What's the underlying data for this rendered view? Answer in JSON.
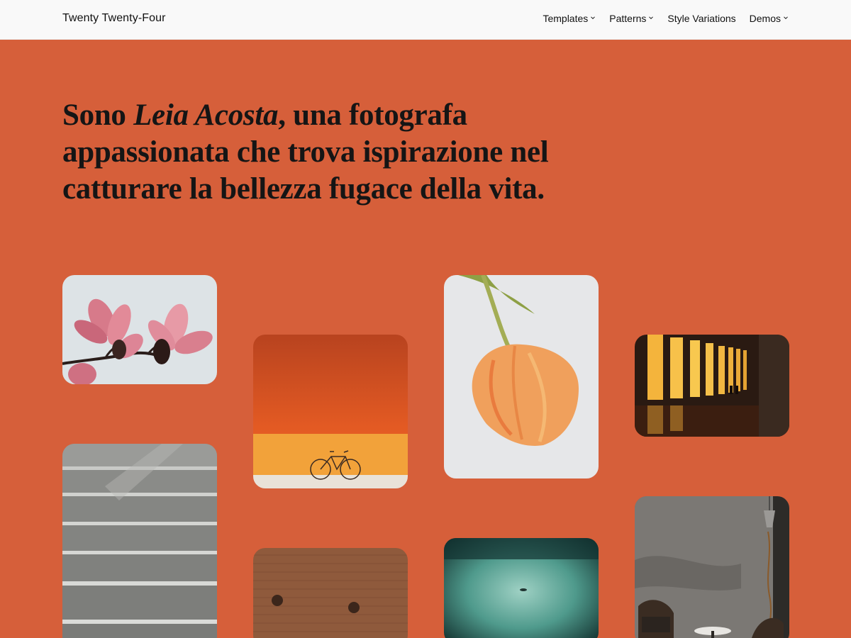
{
  "header": {
    "site_title": "Twenty Twenty-Four",
    "nav": [
      {
        "label": "Templates",
        "has_dropdown": true
      },
      {
        "label": "Patterns",
        "has_dropdown": true
      },
      {
        "label": "Style Variations",
        "has_dropdown": false
      },
      {
        "label": "Demos",
        "has_dropdown": true
      }
    ]
  },
  "hero": {
    "prefix": "Sono ",
    "name": "Leia Acosta",
    "rest_line1": ", una fotografa",
    "line2": "appassionata che trova ispirazione nel",
    "line3": "catturare la bellezza fugace della vita."
  },
  "colors": {
    "background": "#d65f3a",
    "header_bg": "#f9f9f9",
    "text": "#151515"
  },
  "gallery": [
    {
      "subject": "magnolia-flowers"
    },
    {
      "subject": "orange-wall-bicycle"
    },
    {
      "subject": "orange-tulip"
    },
    {
      "subject": "lit-corridor-silhouettes"
    },
    {
      "subject": "concrete-stairs"
    },
    {
      "subject": "brick-wall"
    },
    {
      "subject": "misty-teal-water"
    },
    {
      "subject": "interior-chairs-lamp"
    }
  ]
}
